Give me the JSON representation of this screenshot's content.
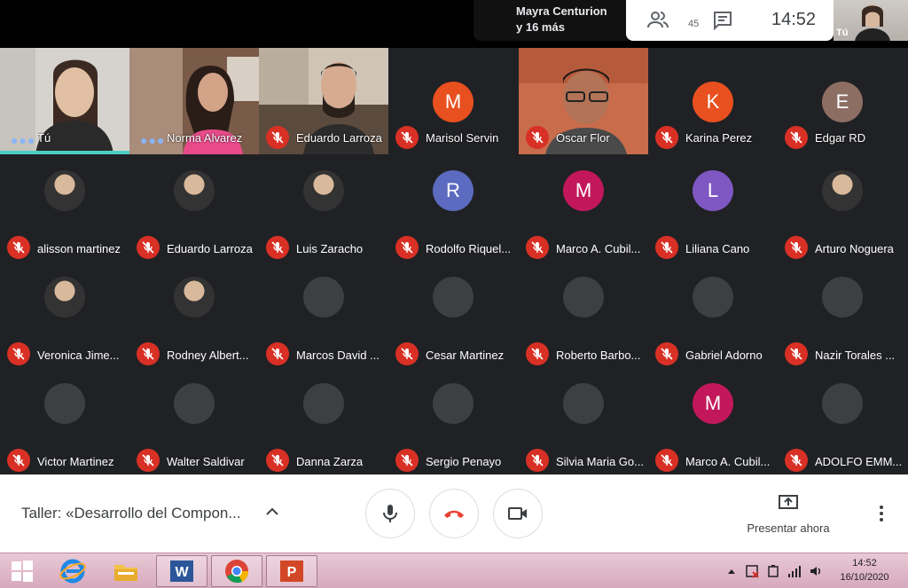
{
  "header": {
    "speaker_line1": "Mayra Centurion",
    "speaker_line2": "y 16 más",
    "people_count": "45",
    "clock": "14:52",
    "self_label": "Tú"
  },
  "video_tiles": [
    {
      "name": "Tú"
    },
    {
      "name": "Norma Alvarez"
    },
    {
      "name": "Eduardo Larroza"
    },
    {
      "name": "Marisol Servin",
      "initial": "M",
      "color": "#e8501f"
    },
    {
      "name": "Oscar Flor"
    },
    {
      "name": "Karina Perez",
      "initial": "K",
      "color": "#e8501f"
    },
    {
      "name": "Edgar RD",
      "initial": "E",
      "color": "#8d6e63"
    }
  ],
  "grid_tiles": [
    {
      "name": "alisson martinez",
      "type": "photo"
    },
    {
      "name": "Eduardo Larroza",
      "type": "photo"
    },
    {
      "name": "Luis Zaracho",
      "type": "photo"
    },
    {
      "name": "Rodolfo Riquel...",
      "type": "letter",
      "initial": "R",
      "color": "#5c6bc0"
    },
    {
      "name": "Marco A. Cubil...",
      "type": "letter",
      "initial": "M",
      "color": "#c2185b"
    },
    {
      "name": "Liliana Cano",
      "type": "letter",
      "initial": "L",
      "color": "#7e57c2"
    },
    {
      "name": "Arturo Noguera",
      "type": "photo"
    },
    {
      "name": "Veronica Jime...",
      "type": "photo"
    },
    {
      "name": "Rodney Albert...",
      "type": "photo"
    },
    {
      "name": "Marcos David ...",
      "type": "gray"
    },
    {
      "name": "Cesar Martinez",
      "type": "gray"
    },
    {
      "name": "Roberto Barbo...",
      "type": "gray"
    },
    {
      "name": "Gabriel Adorno",
      "type": "gray"
    },
    {
      "name": "Nazir Torales ...",
      "type": "gray"
    },
    {
      "name": "Victor Martinez",
      "type": "gray"
    },
    {
      "name": "Walter Saldivar",
      "type": "gray"
    },
    {
      "name": "Danna Zarza",
      "type": "gray"
    },
    {
      "name": "Sergio Penayo",
      "type": "gray"
    },
    {
      "name": "Silvia Maria Go...",
      "type": "gray"
    },
    {
      "name": "Marco A. Cubil...",
      "type": "letter",
      "initial": "M",
      "color": "#c2185b"
    },
    {
      "name": "ADOLFO EMM...",
      "type": "gray"
    }
  ],
  "controls": {
    "meeting_title": "Taller: «Desarrollo del Compon...",
    "present_label": "Presentar ahora"
  },
  "taskbar": {
    "time": "14:52",
    "date": "16/10/2020"
  },
  "colors": {
    "background": "#202124",
    "muted_red": "#d93025",
    "hangup_red": "#ea4335"
  }
}
